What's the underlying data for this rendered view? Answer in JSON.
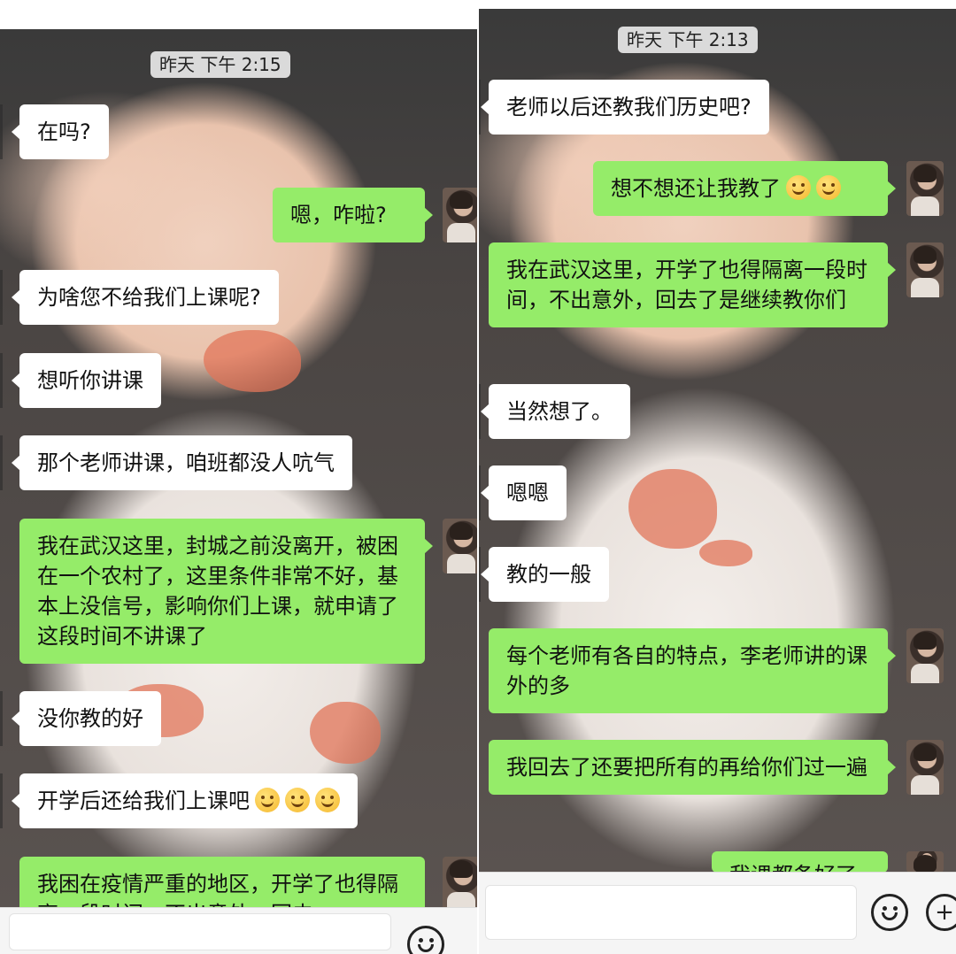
{
  "left": {
    "timestamp": "昨天 下午 2:15",
    "messages": [
      {
        "side": "received",
        "text": "在吗?"
      },
      {
        "side": "sent",
        "text": "嗯，咋啦?"
      },
      {
        "side": "received",
        "text": "为啥您不给我们上课呢?"
      },
      {
        "side": "received",
        "text": "想听你讲课"
      },
      {
        "side": "received",
        "text": "那个老师讲课，咱班都没人吭气"
      },
      {
        "side": "sent",
        "text": "我在武汉这里，封城之前没离开，被困在一个农村了，这里条件非常不好，基本上没信号，影响你们上课，就申请了这段时间不讲课了"
      },
      {
        "side": "received",
        "text": "没你教的好"
      },
      {
        "side": "received",
        "text": "开学后还给我们上课吧",
        "emoji": [
          "smiling-face-icon",
          "blush-face-icon",
          "blush-face-icon"
        ]
      },
      {
        "side": "sent",
        "text": "我困在疫情严重的地区，开学了也得隔离一段时间，不出意外，回去"
      }
    ]
  },
  "right": {
    "timestamp": "昨天 下午 2:13",
    "messages": [
      {
        "side": "received",
        "text": "老师以后还教我们历史吧?"
      },
      {
        "side": "sent",
        "text": "想不想还让我教了",
        "emoji": [
          "tears-of-joy-icon",
          "tears-of-joy-icon"
        ]
      },
      {
        "side": "sent",
        "text": "我在武汉这里，开学了也得隔离一段时间，不出意外，回去了是继续教你们"
      },
      {
        "side": "received",
        "text": "当然想了。"
      },
      {
        "side": "received",
        "text": "嗯嗯"
      },
      {
        "side": "received",
        "text": "教的一般"
      },
      {
        "side": "sent",
        "text": "每个老师有各自的特点，李老师讲的课外的多"
      },
      {
        "side": "sent",
        "text": "我回去了还要把所有的再给你们过一遍"
      },
      {
        "side": "sent",
        "text": "我课都备好了"
      }
    ]
  },
  "toolbar": {
    "emoji_button_icon": "smiley-icon",
    "plus_button_icon": "plus-icon",
    "plus_glyph": "+"
  },
  "colors": {
    "sent_bubble": "#95ec69",
    "received_bubble": "#ffffff",
    "timestamp_bg": "#e8e8e8"
  }
}
